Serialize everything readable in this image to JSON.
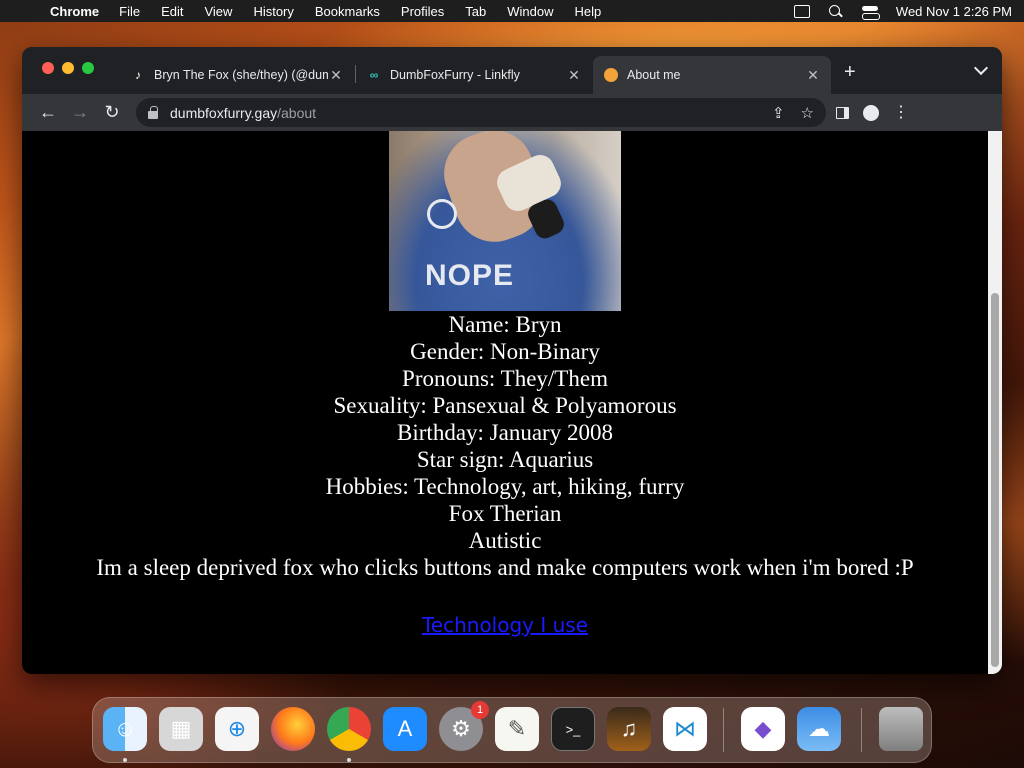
{
  "menubar": {
    "app_name": "Chrome",
    "menus": [
      "File",
      "Edit",
      "View",
      "History",
      "Bookmarks",
      "Profiles",
      "Tab",
      "Window",
      "Help"
    ],
    "clock": "Wed Nov 1  2:26 PM"
  },
  "browser": {
    "tabs": [
      {
        "title": "Bryn The Fox (she/they) (@dumbfoxfurry)",
        "icon": "tiktok-icon",
        "active": false
      },
      {
        "title": "DumbFoxFurry - Linkfly",
        "icon": "linkfly-icon",
        "active": false
      },
      {
        "title": "About me",
        "icon": "fox-icon",
        "active": true
      }
    ],
    "url_host": "dumbfoxfurry.gay",
    "url_path": "/about"
  },
  "page": {
    "profile_lines": [
      "Name: Bryn",
      "Gender: Non-Binary",
      "Pronouns: They/Them",
      "Sexuality: Pansexual & Polyamorous",
      "Birthday: January 2008",
      "Star sign: Aquarius",
      "Hobbies: Technology, art, hiking, furry",
      "Fox Therian",
      "Autistic"
    ],
    "tagline": "Im a sleep deprived fox who clicks buttons and make computers work when i'm bored :P",
    "tech_link": "Technology I use",
    "photo_print": "NOPE"
  },
  "dock": {
    "apps": [
      "Finder",
      "Launchpad",
      "Safari",
      "Firefox",
      "Google Chrome",
      "App Store",
      "System Settings",
      "TextEdit",
      "Terminal",
      "GarageBand",
      "Visual Studio Code",
      "Visual Studio",
      "Weather",
      "Trash"
    ],
    "settings_badge": "1",
    "terminal_prompt": ">_"
  },
  "colors": {
    "link": "#1a1aff",
    "page_background": "#000000",
    "page_text": "#ffffff"
  }
}
